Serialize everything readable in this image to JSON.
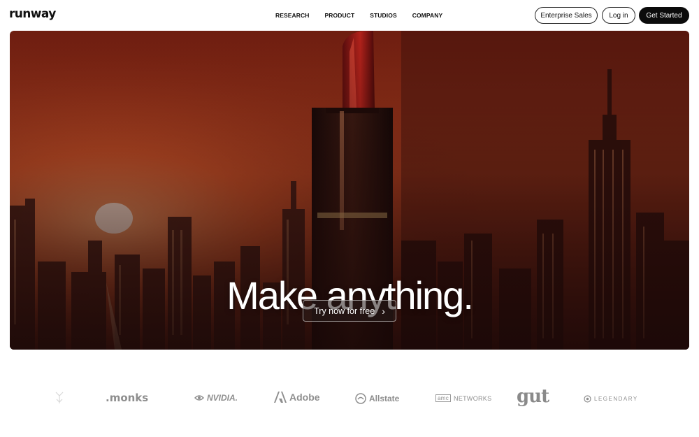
{
  "header": {
    "logo": "runway",
    "nav": [
      "RESEARCH",
      "PRODUCT",
      "STUDIOS",
      "COMPANY"
    ],
    "enterprise_label": "Enterprise Sales",
    "login_label": "Log in",
    "get_started_label": "Get Started"
  },
  "hero": {
    "headline": "Make anything.",
    "cta_label": "Try now for free",
    "cta_icon": "chevron-right-icon",
    "image_subject": "giant lipstick tube towering over a city skyline at sunset"
  },
  "logos": {
    "monks": ".monks",
    "nvidia": "NVIDIA.",
    "adobe": "Adobe",
    "allstate": "Allstate",
    "amc_box": "amc",
    "amc_rest": "NETWORKS",
    "gut": "gut",
    "legendary": "LEGENDARY"
  },
  "colors": {
    "sky_top": "#7a2314",
    "sky_glow": "#e0622f",
    "button_dark": "#0b0b0b",
    "logo_gray": "#8e8e8e"
  }
}
